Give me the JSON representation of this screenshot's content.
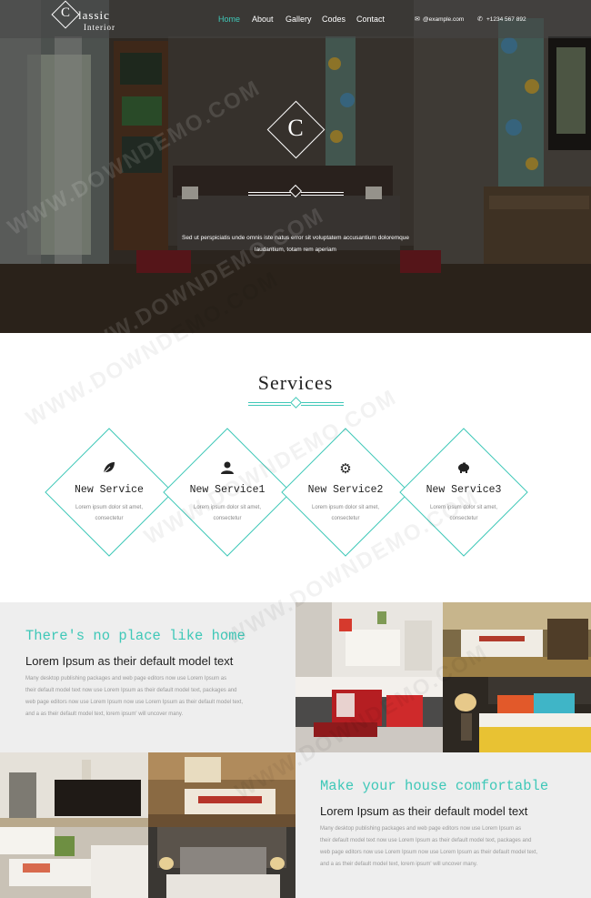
{
  "header": {
    "logo_letter": "C",
    "logo_word": "lassic",
    "logo_sub": "Interior",
    "nav": [
      "Home",
      "About",
      "Gallery",
      "Codes",
      "Contact"
    ],
    "active_nav": "Home",
    "email": "@example.com",
    "phone": "+1234 567 892",
    "icons": [
      "mail-icon",
      "phone-icon"
    ]
  },
  "hero": {
    "letter": "C",
    "text_line1": "Sed ut perspiciatis unde omnis iste natus error sit voluptatem accusantium doloremque",
    "text_line2": "laudantium, totam rem aperiam"
  },
  "services": {
    "title": "Services",
    "items": [
      {
        "name": "New Service",
        "icon": "leaf-icon",
        "desc1": "Lorem ipsum dolor sit amet,",
        "desc2": "consectetur"
      },
      {
        "name": "New Service1",
        "icon": "user-icon",
        "desc1": "Lorem ipsum dolor sit amet,",
        "desc2": "consectetur"
      },
      {
        "name": "New Service2",
        "icon": "gear-icon",
        "desc1": "Lorem ipsum dolor sit amet,",
        "desc2": "consectetur"
      },
      {
        "name": "New Service3",
        "icon": "piggy-bank-icon",
        "desc1": "Lorem ipsum dolor sit amet,",
        "desc2": "consectetur"
      }
    ]
  },
  "feature1": {
    "title": "There's no place like home",
    "subtitle": "Lorem Ipsum as their default model text",
    "body": [
      "Many desktop publishing packages and web page editors now use Lorem Ipsum as",
      "their default model text now use Lorem Ipsum as their default model text, packages and",
      "web page editors now use Lorem Ipsum now use Lorem Ipsum as their default model text,",
      "and a as their default model text, lorem ipsum' will uncover many."
    ]
  },
  "feature2": {
    "title": "Make your house comfortable",
    "subtitle": "Lorem Ipsum as their default model text",
    "body": [
      "Many desktop publishing packages and web page editors now use Lorem Ipsum as",
      "their default model text now use Lorem Ipsum as their default model text, packages and",
      "web page editors now use Lorem Ipsum now use Lorem Ipsum as their default model text,",
      "and a as their default model text, lorem ipsum' will uncover many."
    ]
  },
  "watermark": "WWW.DOWNDEMO.COM",
  "colors": {
    "accent": "#3fc8b8",
    "gray_bg": "#eeeeee"
  }
}
